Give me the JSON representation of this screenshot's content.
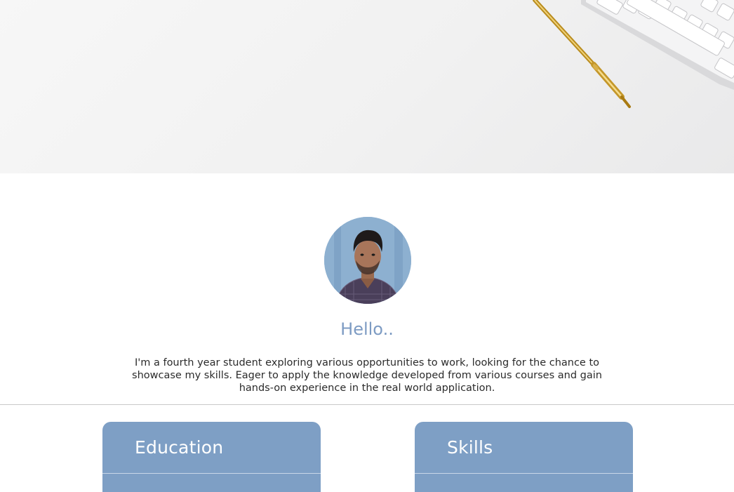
{
  "hero": {
    "image": "desk-banner-with-pen-and-keyboard"
  },
  "profile": {
    "photo": "profile-avatar-photo",
    "greeting": "Hello..",
    "intro": "I'm a fourth year student exploring various opportunities to work, looking for the chance to showcase my skills. Eager to apply the knowledge developed from various courses and gain hands-on experience in the real world application."
  },
  "sections": {
    "education": {
      "title": "Education"
    },
    "skills": {
      "title": "Skills"
    }
  },
  "colors": {
    "accent": "#7e9fc5",
    "greeting": "#7d9bc3",
    "text": "#2b2b2b"
  }
}
